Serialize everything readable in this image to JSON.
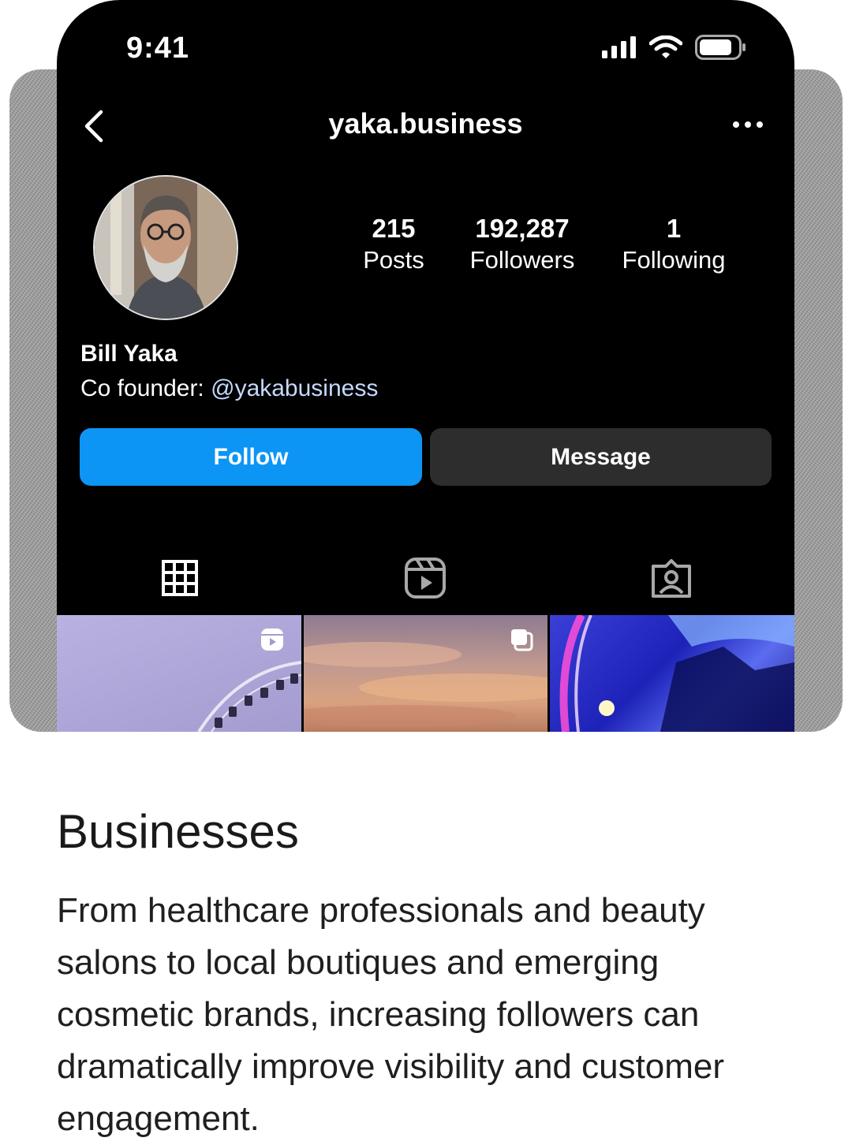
{
  "status_bar": {
    "time": "9:41",
    "signal_icon": "signal-bars-icon",
    "wifi_icon": "wifi-icon",
    "battery_icon": "battery-icon"
  },
  "header": {
    "username": "yaka.business",
    "back_icon": "chevron-left-icon",
    "more_icon": "more-dots-icon"
  },
  "profile": {
    "stats": [
      {
        "value": "215",
        "label": "Posts"
      },
      {
        "value": "192,287",
        "label": "Followers"
      },
      {
        "value": "1",
        "label": "Following"
      }
    ],
    "name": "Bill Yaka",
    "bio_prefix": "Co founder: ",
    "bio_mention": "@yakabusiness"
  },
  "actions": {
    "follow_label": "Follow",
    "message_label": "Message",
    "follow_color": "#0d95f6"
  },
  "tabs": [
    {
      "icon": "grid-icon",
      "active": true
    },
    {
      "icon": "reels-icon",
      "active": false
    },
    {
      "icon": "tagged-icon",
      "active": false
    }
  ],
  "posts": [
    {
      "badge_icon": "reel-badge-icon"
    },
    {
      "badge_icon": "carousel-badge-icon"
    },
    {
      "badge_icon": ""
    }
  ],
  "section": {
    "heading": "Businesses",
    "description": "From healthcare professionals and beauty salons to local boutiques and emerging cosmetic brands, increasing followers can dramatically improve visibility and customer engagement."
  }
}
